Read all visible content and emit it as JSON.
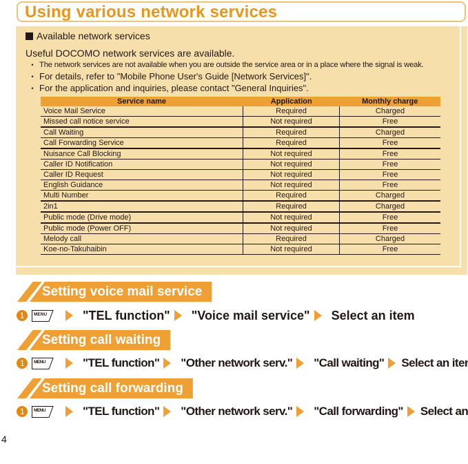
{
  "page_title": "Using various network services",
  "panel": {
    "subhead": "Available network services",
    "lead": "Useful DOCOMO network services are available.",
    "bullets": [
      "The network services are not available when you are outside the service area or in a place where the signal is weak.",
      "For details, refer to \"Mobile Phone User's Guide [Network Services]\".",
      "For the application and inquiries, please contact \"General Inquiries\"."
    ],
    "bullet_glyph": "・",
    "table": {
      "headers": [
        "Service name",
        "Application",
        "Monthly charge"
      ],
      "rows": [
        [
          "Voice Mail Service",
          "Required",
          "Charged"
        ],
        [
          "Missed call notice service",
          "Not required",
          "Free"
        ],
        [
          "Call Waiting",
          "Required",
          "Charged"
        ],
        [
          "Call Forwarding Service",
          "Required",
          "Free"
        ],
        [
          "Nuisance Call Blocking",
          "Not required",
          "Free"
        ],
        [
          "Caller ID Notification",
          "Not required",
          "Free"
        ],
        [
          "Caller ID Request",
          "Not required",
          "Free"
        ],
        [
          "English Guidance",
          "Not required",
          "Free"
        ],
        [
          "Multi Number",
          "Required",
          "Charged"
        ],
        [
          "2in1",
          "Required",
          "Charged"
        ],
        [
          "Public mode (Drive mode)",
          "Not required",
          "Free"
        ],
        [
          "Public mode (Power OFF)",
          "Not required",
          "Free"
        ],
        [
          "Melody call",
          "Required",
          "Charged"
        ],
        [
          "Koe-no-Takuhaibin",
          "Not required",
          "Free"
        ]
      ]
    }
  },
  "sections": [
    {
      "title": "Setting voice mail service",
      "step_number": "1",
      "key_label": "MENU",
      "steps": [
        "\"TEL function\"",
        "\"Voice mail service\"",
        "Select an item"
      ]
    },
    {
      "title": "Setting call waiting",
      "step_number": "1",
      "key_label": "MENU",
      "steps": [
        "\"TEL function\"",
        "\"Other network serv.\"",
        "\"Call waiting\"",
        "Select an item"
      ]
    },
    {
      "title": "Setting call forwarding",
      "step_number": "1",
      "key_label": "MENU",
      "steps": [
        "\"TEL function\"",
        "\"Other network serv.\"",
        "\"Call forwarding\"",
        "Select an item"
      ]
    }
  ],
  "page_number": "4",
  "colors": {
    "accent_orange": "#eea035",
    "title_orange": "#e8961e",
    "panel_beige": "#f7dfac",
    "title_border": "#f0c27a",
    "step_circle": "#e3870f"
  }
}
